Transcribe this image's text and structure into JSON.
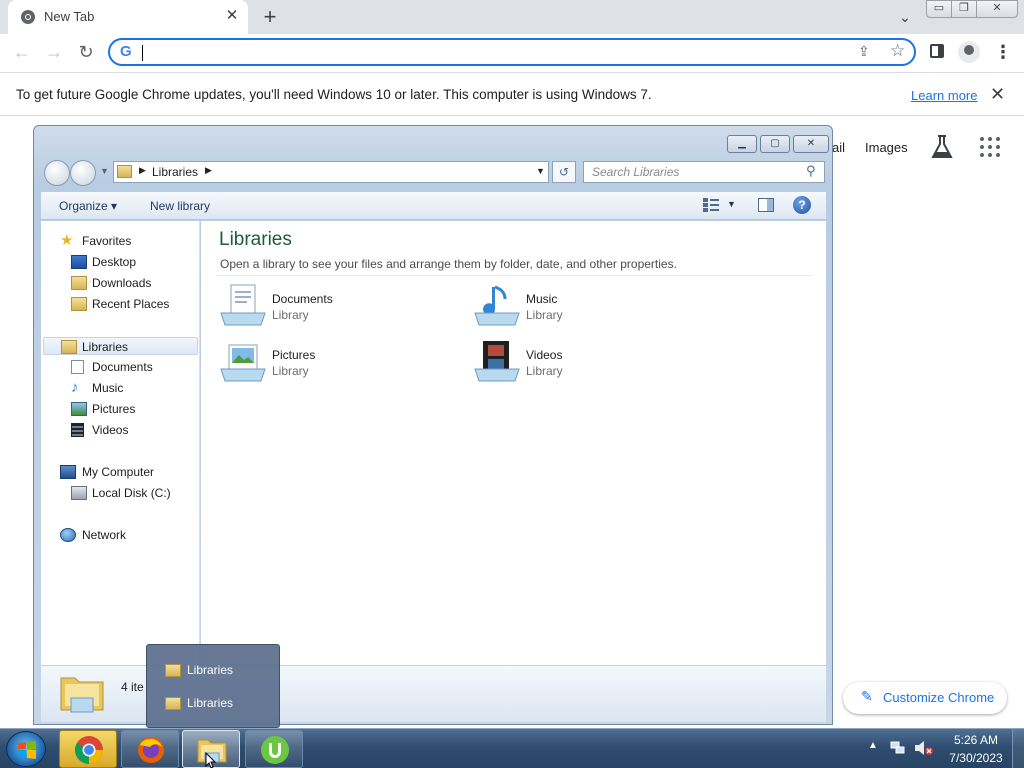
{
  "chrome": {
    "tab_title": "New Tab",
    "tab_close": "✕",
    "new_tab": "+",
    "tab_search": "⌄",
    "caption": {
      "minimize": "▭",
      "maximize": "❐",
      "close": "✕"
    },
    "nav": {
      "back": "←",
      "forward": "→",
      "reload": "↻"
    },
    "omnibox": {
      "value": "",
      "g_letter": "G"
    },
    "share_icon": "⇪",
    "bookmark_star": "☆",
    "menu": "⋮"
  },
  "infobar": {
    "message": "To get future Google Chrome updates, you'll need Windows 10 or later. This computer is using Windows 7.",
    "learn_more": "Learn more",
    "close": "✕"
  },
  "ntp": {
    "gmail": "ail",
    "images": "Images",
    "customize_label": "Customize Chrome",
    "customize_icon": "✎"
  },
  "explorer": {
    "window_buttons": {
      "minimize": "▁",
      "maximize": "▢",
      "close": "✕"
    },
    "address": {
      "arrow": "▶",
      "crumb": "Libraries",
      "dropdown": "▼"
    },
    "refresh": "↺",
    "search_placeholder": "Search Libraries",
    "search_icon": "⚲",
    "commands": {
      "organize": "Organize ▾",
      "new_library": "New library",
      "views_drop": "▼",
      "help": "?"
    },
    "nav_pane": {
      "favorites": "Favorites",
      "desktop": "Desktop",
      "downloads": "Downloads",
      "recent": "Recent Places",
      "libraries": "Libraries",
      "documents": "Documents",
      "music": "Music",
      "pictures": "Pictures",
      "videos": "Videos",
      "my_computer": "My Computer",
      "local_disk": "Local Disk (C:)",
      "network": "Network"
    },
    "content": {
      "title": "Libraries",
      "subtitle": "Open a library to see your files and arrange them by folder, date, and other properties.",
      "items": [
        {
          "name": "Documents",
          "type": "Library",
          "icon": "documents-library-icon"
        },
        {
          "name": "Music",
          "type": "Library",
          "icon": "music-library-icon"
        },
        {
          "name": "Pictures",
          "type": "Library",
          "icon": "pictures-library-icon"
        },
        {
          "name": "Videos",
          "type": "Library",
          "icon": "videos-library-icon"
        }
      ]
    },
    "details": {
      "count": "4 ite"
    }
  },
  "thumbnail_popup": {
    "items": [
      "Libraries",
      "Libraries"
    ]
  },
  "taskbar": {
    "tray_up": "▲",
    "time": "5:26 AM",
    "date": "7/30/2023"
  }
}
